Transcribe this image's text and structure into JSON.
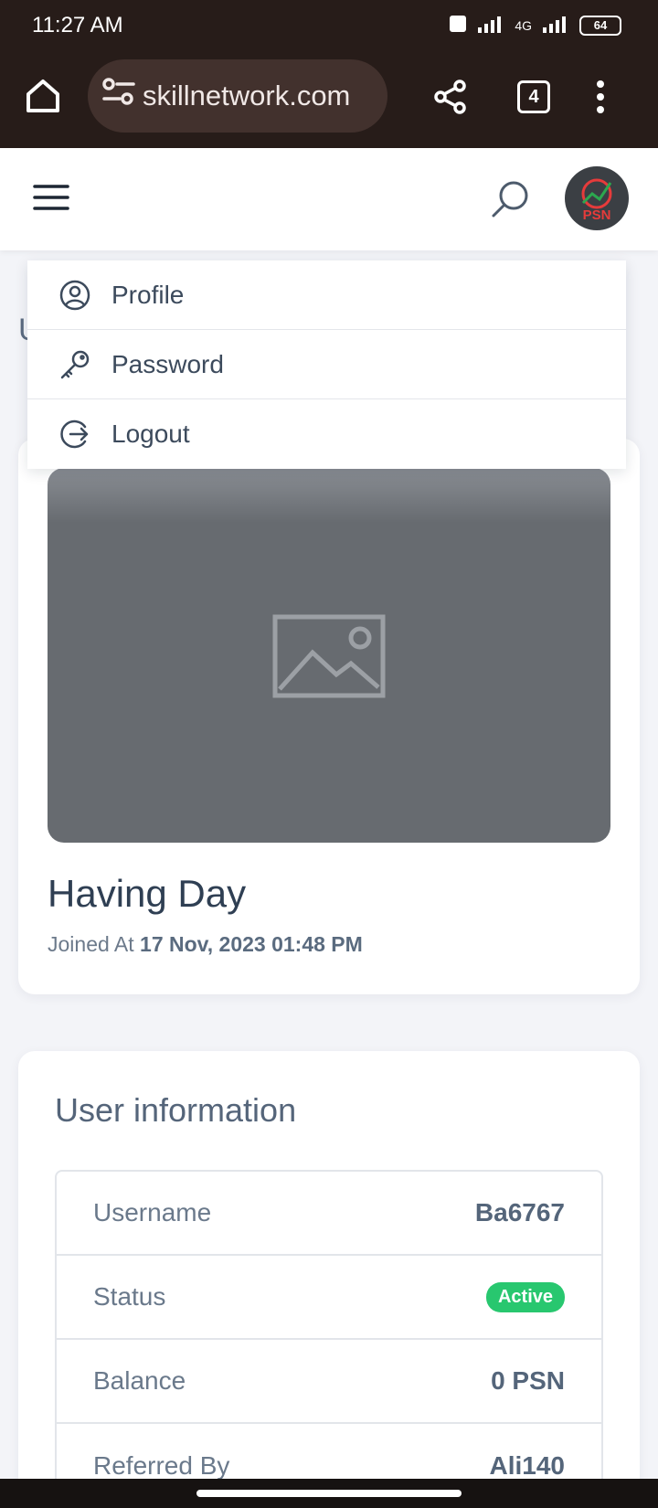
{
  "status_bar": {
    "time": "11:27 AM",
    "network": "4G",
    "battery": "64"
  },
  "browser": {
    "url": "skillnetwork.com",
    "tab_count": "4"
  },
  "site": {
    "avatar_text": "PSN"
  },
  "dropdown": {
    "items": [
      {
        "label": "Profile",
        "icon": "user-circle-icon"
      },
      {
        "label": "Password",
        "icon": "key-icon"
      },
      {
        "label": "Logout",
        "icon": "logout-icon"
      }
    ]
  },
  "profile": {
    "name": "Having Day",
    "joined_label": "Joined At",
    "joined_date": "17 Nov, 2023 01:48 PM"
  },
  "user_info": {
    "title": "User information",
    "rows": [
      {
        "label": "Username",
        "value": "Ba6767"
      },
      {
        "label": "Status",
        "value": "Active"
      },
      {
        "label": "Balance",
        "value": "0 PSN"
      },
      {
        "label": "Referred By",
        "value": "Ali140"
      }
    ]
  },
  "colors": {
    "status_active": "#28c76f",
    "browser_chrome": "#271c19"
  }
}
